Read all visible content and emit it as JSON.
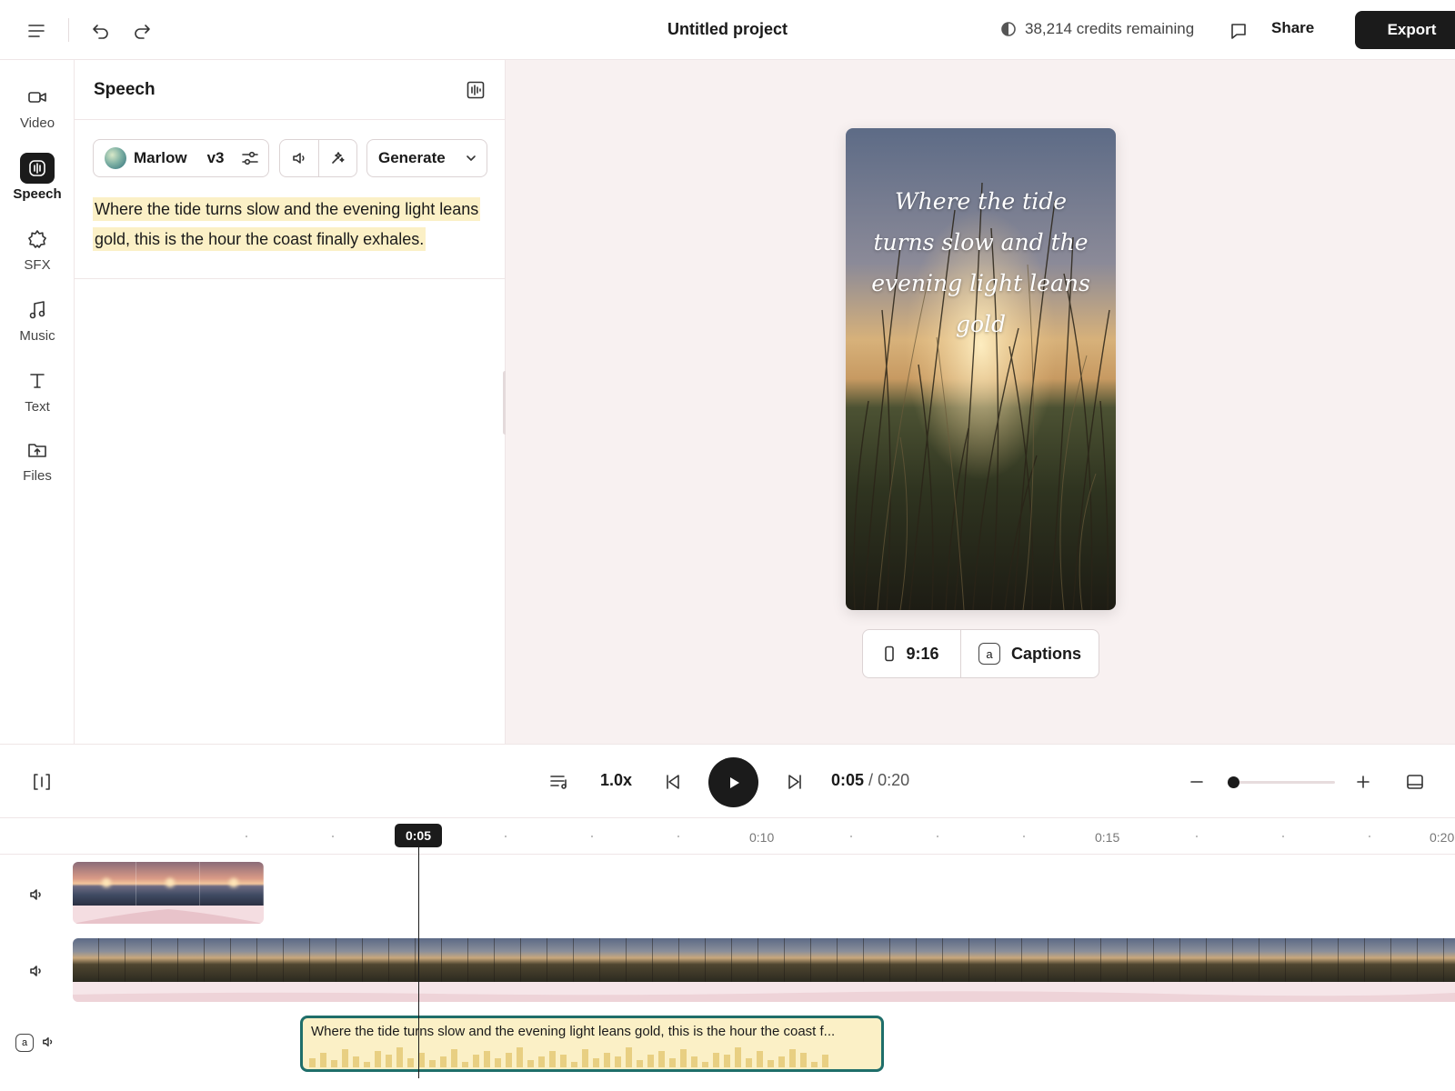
{
  "header": {
    "title": "Untitled project",
    "credits": "38,214 credits remaining",
    "share": "Share",
    "export": "Export"
  },
  "rail": {
    "items": [
      {
        "label": "Video",
        "icon": "video-camera-icon"
      },
      {
        "label": "Speech",
        "icon": "speech-waveform-icon",
        "active": true
      },
      {
        "label": "SFX",
        "icon": "sfx-burst-icon"
      },
      {
        "label": "Music",
        "icon": "music-note-icon"
      },
      {
        "label": "Text",
        "icon": "text-t-icon"
      },
      {
        "label": "Files",
        "icon": "folder-upload-icon"
      }
    ]
  },
  "panel": {
    "title": "Speech",
    "voice": {
      "name": "Marlow",
      "model": "v3"
    },
    "generate": "Generate",
    "script": "Where the tide turns slow and the evening light leans gold, this is the hour the coast finally exhales."
  },
  "preview": {
    "caption": "Where the tide turns slow and the evening light leans gold",
    "ratio": "9:16",
    "captions_label": "Captions",
    "captions_badge": "a"
  },
  "transport": {
    "speed": "1.0x",
    "current": "0:05",
    "separator": "/",
    "total": "0:20",
    "zoom": 0
  },
  "timeline": {
    "playhead": "0:05",
    "ticks": [
      "0:10",
      "0:15",
      "0:20"
    ],
    "speech_clip_text": "Where the tide turns slow and the evening light leans gold, this is the hour the coast f...",
    "caption_track_badge": "a"
  },
  "colors": {
    "accent_dark": "#1b1b1b",
    "highlight": "#fbf0c6",
    "clip_border": "#1f6e6a",
    "preview_bg": "#f8f1f1"
  }
}
